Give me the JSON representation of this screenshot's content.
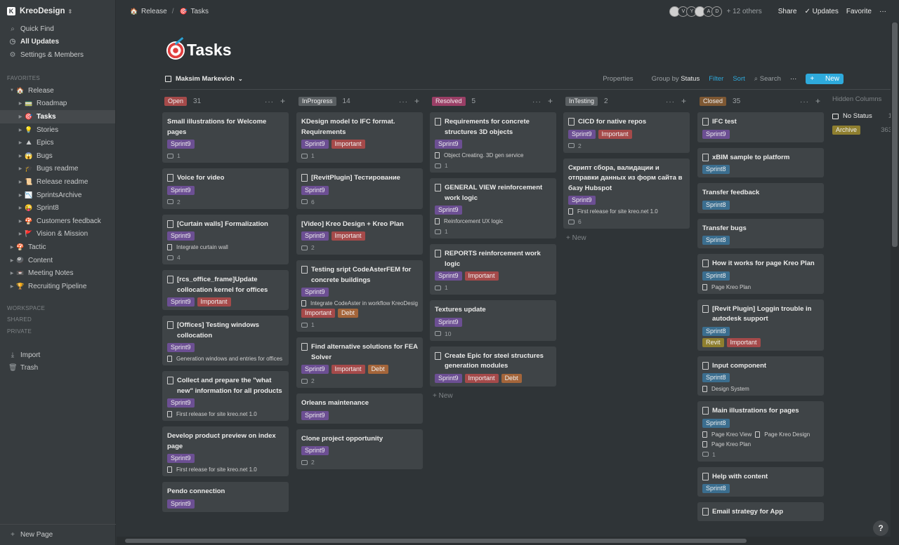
{
  "sidebar": {
    "workspace": "KreoDesign",
    "quick_find": "Quick Find",
    "all_updates": "All Updates",
    "settings": "Settings & Members",
    "favorites_label": "FAVORITES",
    "favorites": [
      {
        "label": "Release",
        "emoji": "🏠",
        "level": 0,
        "open": true,
        "active": false
      },
      {
        "label": "Roadmap",
        "emoji": "🚃",
        "level": 1,
        "open": false,
        "active": false
      },
      {
        "label": "Tasks",
        "emoji": "🎯",
        "level": 1,
        "open": false,
        "active": true
      },
      {
        "label": "Stories",
        "emoji": "💡",
        "level": 1,
        "open": false,
        "active": false
      },
      {
        "label": "Epics",
        "emoji": "⛰",
        "level": 1,
        "open": false,
        "active": false
      },
      {
        "label": "Bugs",
        "emoji": "😱",
        "level": 1,
        "open": false,
        "active": false
      },
      {
        "label": "Bugs readme",
        "emoji": "🎓",
        "level": 1,
        "open": false,
        "active": false
      },
      {
        "label": "Release readme",
        "emoji": "📜",
        "level": 1,
        "open": false,
        "active": false
      },
      {
        "label": "SprintsArchive",
        "emoji": "📉",
        "level": 1,
        "open": false,
        "active": false
      },
      {
        "label": "Sprint8",
        "emoji": "😜",
        "level": 1,
        "open": false,
        "active": false
      },
      {
        "label": "Customers feedback",
        "emoji": "🍄",
        "level": 1,
        "open": false,
        "active": false
      },
      {
        "label": "Vision & Mission",
        "emoji": "🚩",
        "level": 1,
        "open": false,
        "active": false
      },
      {
        "label": "Tactic",
        "emoji": "🍄",
        "level": 0,
        "open": false,
        "active": false
      },
      {
        "label": "Content",
        "emoji": "🎱",
        "level": 0,
        "open": false,
        "active": false
      },
      {
        "label": "Meeting Notes",
        "emoji": "📼",
        "level": 0,
        "open": false,
        "active": false
      },
      {
        "label": "Recruiting Pipeline",
        "emoji": "🏆",
        "level": 0,
        "open": false,
        "active": false
      }
    ],
    "workspace_label": "WORKSPACE",
    "shared_label": "SHARED",
    "private_label": "PRIVATE",
    "import": "Import",
    "trash": "Trash",
    "new_page": "New Page"
  },
  "topbar": {
    "crumbs": [
      {
        "label": "Release",
        "emoji": "🏠"
      },
      {
        "label": "Tasks",
        "emoji": "🎯"
      }
    ],
    "crumb_sep": "/",
    "avatars": [
      "",
      "V",
      "Y",
      "",
      "A",
      "D"
    ],
    "others": "+ 12 others",
    "share": "Share",
    "updates": "Updates",
    "favorite": "Favorite",
    "more": "···"
  },
  "page": {
    "title": "Tasks",
    "view_name": "Maksim Markevich",
    "properties": "Properties",
    "group_by_prefix": "Group by",
    "group_by_value": "Status",
    "filter": "Filter",
    "sort": "Sort",
    "search": "Search",
    "more": "···",
    "new_button": "New"
  },
  "columns": [
    {
      "name": "Open",
      "count": "31",
      "color": "c-red",
      "new_label": "",
      "cards": [
        {
          "title": "Small illustrations for Welcome pages",
          "doc": false,
          "tags": [
            {
              "label": "Sprint9",
              "color": "c-purple"
            }
          ],
          "relations": [],
          "comments": "1"
        },
        {
          "title": "Voice for video",
          "doc": true,
          "tags": [
            {
              "label": "Sprint9",
              "color": "c-purple"
            }
          ],
          "relations": [],
          "comments": "2"
        },
        {
          "title": "[Curtain walls] Formalization",
          "doc": true,
          "tags": [
            {
              "label": "Sprint9",
              "color": "c-purple"
            }
          ],
          "relations": [
            "Integrate curtain wall"
          ],
          "comments": "4"
        },
        {
          "title": "[rcs_office_frame]Update collocation kernel for offices",
          "doc": true,
          "tags": [
            {
              "label": "Sprint9",
              "color": "c-purple"
            },
            {
              "label": "Important",
              "color": "c-red"
            }
          ],
          "relations": [],
          "comments": ""
        },
        {
          "title": "[Offices] Testing windows collocation",
          "doc": true,
          "tags": [
            {
              "label": "Sprint9",
              "color": "c-purple"
            }
          ],
          "relations": [
            "Generation windows and entries for offices"
          ],
          "comments": ""
        },
        {
          "title": "Collect and prepare the \"what new\" information for all products",
          "doc": true,
          "tags": [
            {
              "label": "Sprint9",
              "color": "c-purple"
            }
          ],
          "relations": [
            "First release for site kreo.net 1.0"
          ],
          "comments": ""
        },
        {
          "title": "Develop product preview on index page",
          "doc": false,
          "tags": [
            {
              "label": "Sprint9",
              "color": "c-purple"
            }
          ],
          "relations": [
            "First release for site kreo.net 1.0"
          ],
          "comments": ""
        },
        {
          "title": "Pendo connection",
          "doc": false,
          "tags": [
            {
              "label": "Sprint9",
              "color": "c-purple"
            }
          ],
          "relations": [],
          "comments": ""
        }
      ]
    },
    {
      "name": "InProgress",
      "count": "14",
      "color": "c-gray",
      "new_label": "",
      "cards": [
        {
          "title": "KDesign model to IFC format. Requirements",
          "doc": false,
          "tags": [
            {
              "label": "Sprint9",
              "color": "c-purple"
            },
            {
              "label": "Important",
              "color": "c-red"
            }
          ],
          "relations": [],
          "comments": "1"
        },
        {
          "title": "[RevitPlugin] Тестирование",
          "doc": true,
          "tags": [
            {
              "label": "Sprint9",
              "color": "c-purple"
            }
          ],
          "relations": [],
          "comments": "6"
        },
        {
          "title": "[Video] Kreo Design + Kreo Plan",
          "doc": false,
          "tags": [
            {
              "label": "Sprint9",
              "color": "c-purple"
            },
            {
              "label": "Important",
              "color": "c-red"
            }
          ],
          "relations": [],
          "comments": "2"
        },
        {
          "title": "Testing sript CodeAsterFEM for concrete buildings",
          "doc": true,
          "tags": [
            {
              "label": "Sprint9",
              "color": "c-purple"
            }
          ],
          "relations": [
            "Integrate CodeAster in workflow KreoDesign"
          ],
          "tags2": [
            {
              "label": "Important",
              "color": "c-red"
            },
            {
              "label": "Debt",
              "color": "c-orange"
            }
          ],
          "comments": "1"
        },
        {
          "title": "Find alternative solutions for FEA Solver",
          "doc": true,
          "tags": [
            {
              "label": "Sprint9",
              "color": "c-purple"
            },
            {
              "label": "Important",
              "color": "c-red"
            },
            {
              "label": "Debt",
              "color": "c-orange"
            }
          ],
          "relations": [],
          "comments": "2"
        },
        {
          "title": "Orleans maintenance",
          "doc": false,
          "tags": [
            {
              "label": "Sprint9",
              "color": "c-purple"
            }
          ],
          "relations": [],
          "comments": ""
        },
        {
          "title": "Clone project opportunity",
          "doc": false,
          "tags": [
            {
              "label": "Sprint9",
              "color": "c-purple"
            }
          ],
          "relations": [],
          "comments": "2"
        }
      ]
    },
    {
      "name": "Resolved",
      "count": "5",
      "color": "c-pink",
      "new_label": "New",
      "cards": [
        {
          "title": "Requirements for concrete structures 3D objects",
          "doc": true,
          "tags": [
            {
              "label": "Sprint9",
              "color": "c-purple"
            }
          ],
          "relations": [
            "Object Creating. 3D gen service"
          ],
          "comments": "1"
        },
        {
          "title": "GENERAL VIEW reinforcement work logic",
          "doc": true,
          "tags": [
            {
              "label": "Sprint9",
              "color": "c-purple"
            }
          ],
          "relations": [
            "Reinforcement UX logic"
          ],
          "comments": "1"
        },
        {
          "title": "REPORTS reinforcement work logic",
          "doc": true,
          "tags": [
            {
              "label": "Sprint9",
              "color": "c-purple"
            },
            {
              "label": "Important",
              "color": "c-red"
            }
          ],
          "relations": [],
          "comments": "1"
        },
        {
          "title": "Textures update",
          "doc": false,
          "tags": [
            {
              "label": "Sprint9",
              "color": "c-purple"
            }
          ],
          "relations": [],
          "comments": "10"
        },
        {
          "title": "Create Epic for steel structures generation modules",
          "doc": true,
          "tags": [
            {
              "label": "Sprint9",
              "color": "c-purple"
            },
            {
              "label": "Important",
              "color": "c-red"
            },
            {
              "label": "Debt",
              "color": "c-orange"
            }
          ],
          "relations": [],
          "comments": ""
        }
      ]
    },
    {
      "name": "InTesting",
      "count": "2",
      "color": "c-gray",
      "new_label": "New",
      "cards": [
        {
          "title": "CICD for native repos",
          "doc": true,
          "tags": [
            {
              "label": "Sprint9",
              "color": "c-purple"
            },
            {
              "label": "Important",
              "color": "c-red"
            }
          ],
          "relations": [],
          "comments": "2"
        },
        {
          "title": "Скрипт сбора, валидации и отправки данных из форм сайта в базу Hubspot",
          "doc": false,
          "tags": [
            {
              "label": "Sprint9",
              "color": "c-purple"
            }
          ],
          "relations": [
            "First release for site kreo.net 1.0"
          ],
          "comments": "6"
        }
      ]
    },
    {
      "name": "Closed",
      "count": "35",
      "color": "c-brown",
      "new_label": "",
      "cards": [
        {
          "title": "IFC test",
          "doc": true,
          "tags": [
            {
              "label": "Sprint9",
              "color": "c-purple"
            }
          ],
          "relations": [],
          "comments": ""
        },
        {
          "title": "xBIM sample to platform",
          "doc": true,
          "tags": [
            {
              "label": "Sprint8",
              "color": "c-blue"
            }
          ],
          "relations": [],
          "comments": ""
        },
        {
          "title": "Transfer feedback",
          "doc": false,
          "tags": [
            {
              "label": "Sprint8",
              "color": "c-blue"
            }
          ],
          "relations": [],
          "comments": ""
        },
        {
          "title": "Transfer bugs",
          "doc": false,
          "tags": [
            {
              "label": "Sprint8",
              "color": "c-blue"
            }
          ],
          "relations": [],
          "comments": ""
        },
        {
          "title": "How it works for page Kreo Plan",
          "doc": true,
          "tags": [
            {
              "label": "Sprint8",
              "color": "c-blue"
            }
          ],
          "relations": [
            "Page Kreo Plan"
          ],
          "comments": ""
        },
        {
          "title": "[Revit Plugin] Loggin trouble in autodesk support",
          "doc": true,
          "tags": [
            {
              "label": "Sprint8",
              "color": "c-blue"
            }
          ],
          "relations": [],
          "tags2": [
            {
              "label": "Revit",
              "color": "c-yellow"
            },
            {
              "label": "Important",
              "color": "c-red"
            }
          ],
          "comments": ""
        },
        {
          "title": "Input component",
          "doc": true,
          "tags": [
            {
              "label": "Sprint8",
              "color": "c-blue"
            }
          ],
          "relations": [
            "Design System"
          ],
          "comments": ""
        },
        {
          "title": "Main illustrations for pages",
          "doc": true,
          "tags": [
            {
              "label": "Sprint8",
              "color": "c-blue"
            }
          ],
          "relations": [
            "Page Kreo View",
            "Page Kreo Design",
            "Page Kreo Plan"
          ],
          "comments": "1"
        },
        {
          "title": "Help with content",
          "doc": true,
          "tags": [
            {
              "label": "Sprint8",
              "color": "c-blue"
            }
          ],
          "relations": [],
          "comments": ""
        },
        {
          "title": "Email strategy for App",
          "doc": true,
          "tags": [],
          "relations": [],
          "comments": ""
        }
      ]
    }
  ],
  "hidden": {
    "label": "Hidden Columns",
    "items": [
      {
        "label": "No Status",
        "count": "1",
        "tag": false,
        "color": ""
      },
      {
        "label": "Archive",
        "count": "363",
        "tag": true,
        "color": "c-yellow"
      }
    ]
  },
  "help": "?"
}
